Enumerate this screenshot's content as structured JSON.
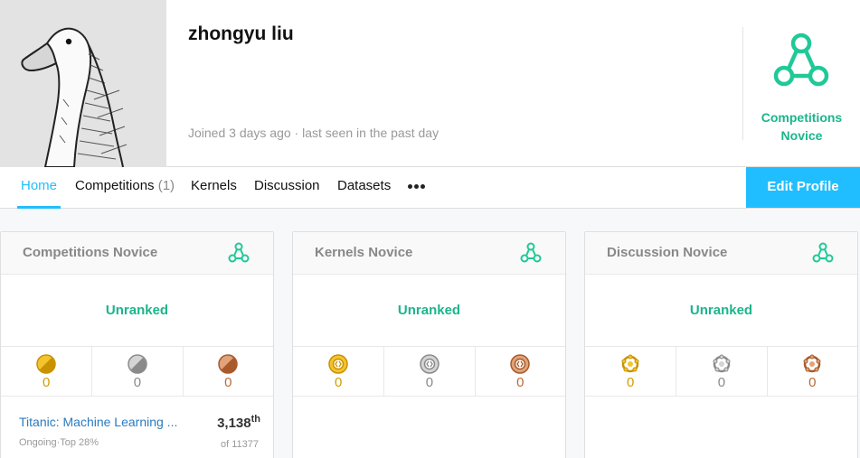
{
  "profile": {
    "name": "zhongyu liu",
    "joined": "Joined 3 days ago · last seen in the past day",
    "tier_label_line1": "Competitions",
    "tier_label_line2": "Novice"
  },
  "nav": {
    "home": "Home",
    "competitions": "Competitions",
    "competitions_count": "(1)",
    "kernels": "Kernels",
    "discussion": "Discussion",
    "datasets": "Datasets",
    "edit_profile": "Edit Profile"
  },
  "cards": [
    {
      "title": "Competitions Novice",
      "rank": "Unranked",
      "gold": "0",
      "silver": "0",
      "bronze": "0",
      "medal_icon": "competition-medal-icon"
    },
    {
      "title": "Kernels Novice",
      "rank": "Unranked",
      "gold": "0",
      "silver": "0",
      "bronze": "0",
      "medal_icon": "kernel-medal-icon"
    },
    {
      "title": "Discussion Novice",
      "rank": "Unranked",
      "gold": "0",
      "silver": "0",
      "bronze": "0",
      "medal_icon": "discussion-medal-icon"
    }
  ],
  "competition_entry": {
    "name": "Titanic: Machine Learning ...",
    "status": "Ongoing·Top 28%",
    "rank": "3,138",
    "rank_suffix": "th",
    "of": "of 11377"
  },
  "colors": {
    "accent": "#20beff",
    "novice": "#1bb58c",
    "gold": "#d49b00",
    "silver": "#8a8a8a",
    "bronze": "#b86b3a"
  }
}
